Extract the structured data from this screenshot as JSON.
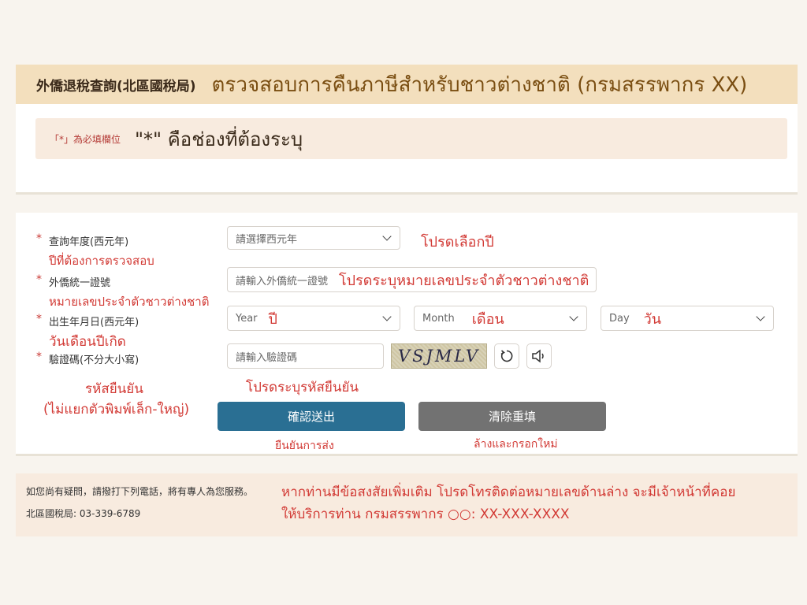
{
  "header": {
    "title": "外僑退稅查詢(北區國稅局)",
    "title_thai": "ตรวจสอบการคืนภาษีสำหรับชาวต่างชาติ (กรมสรรพากร XX)",
    "required_note": "「*」為必填欄位",
    "required_note_thai": "\"*\" คือช่องที่ต้องระบุ"
  },
  "form": {
    "required_mark": "*",
    "year": {
      "label": "查詢年度(西元年)",
      "label_thai": "ปีที่ต้องการตรวจสอบ",
      "placeholder": "請選擇西元年",
      "placeholder_thai": "โปรดเลือกปี"
    },
    "id": {
      "label": "外僑統一證號",
      "label_thai": "หมายเลขประจำตัวชาวต่างชาติ",
      "placeholder": "請輸入外僑統一證號",
      "placeholder_thai": "โปรดระบุหมายเลขประจำตัวชาวต่างชาติ"
    },
    "birth": {
      "label": "出生年月日(西元年)",
      "label_thai": "วันเดือนปีเกิด",
      "year_placeholder": "Year",
      "year_thai": "ปี",
      "month_placeholder": "Month",
      "month_thai": "เดือน",
      "day_placeholder": "Day",
      "day_thai": "วัน"
    },
    "captcha": {
      "label": "驗證碼(不分大小寫)",
      "label_thai_1": "รหัสยืนยัน",
      "label_thai_2": "(ไม่แยกตัวพิมพ์เล็ก-ใหญ่)",
      "placeholder": "請輸入驗證碼",
      "placeholder_thai": "โปรดระบุรหัสยืนยัน",
      "code": "VSJMLV",
      "refresh_icon": "refresh-icon",
      "audio_icon": "speaker-icon"
    },
    "submit_label": "確認送出",
    "submit_thai": "ยืนยันการส่ง",
    "reset_label": "清除重填",
    "reset_thai": "ล้างและกรอกใหม่"
  },
  "help": {
    "line1": "如您尚有疑問，請撥打下列電話，將有專人為您服務。",
    "line2": "北區國稅局: 03-339-6789",
    "thai_line1": "หากท่านมีข้อสงสัยเพิ่มเติม โปรดโทรติดต่อหมายเลขด้านล่าง จะมีเจ้าหน้าที่คอย",
    "thai_line2": "ให้บริการท่าน กรมสรรพากร ○○: XX-XXX-XXXX"
  },
  "colors": {
    "header_bg": "#f3dfbd",
    "primary_button": "#2a6f93",
    "secondary_button": "#727272",
    "required_red": "#c93a35"
  }
}
